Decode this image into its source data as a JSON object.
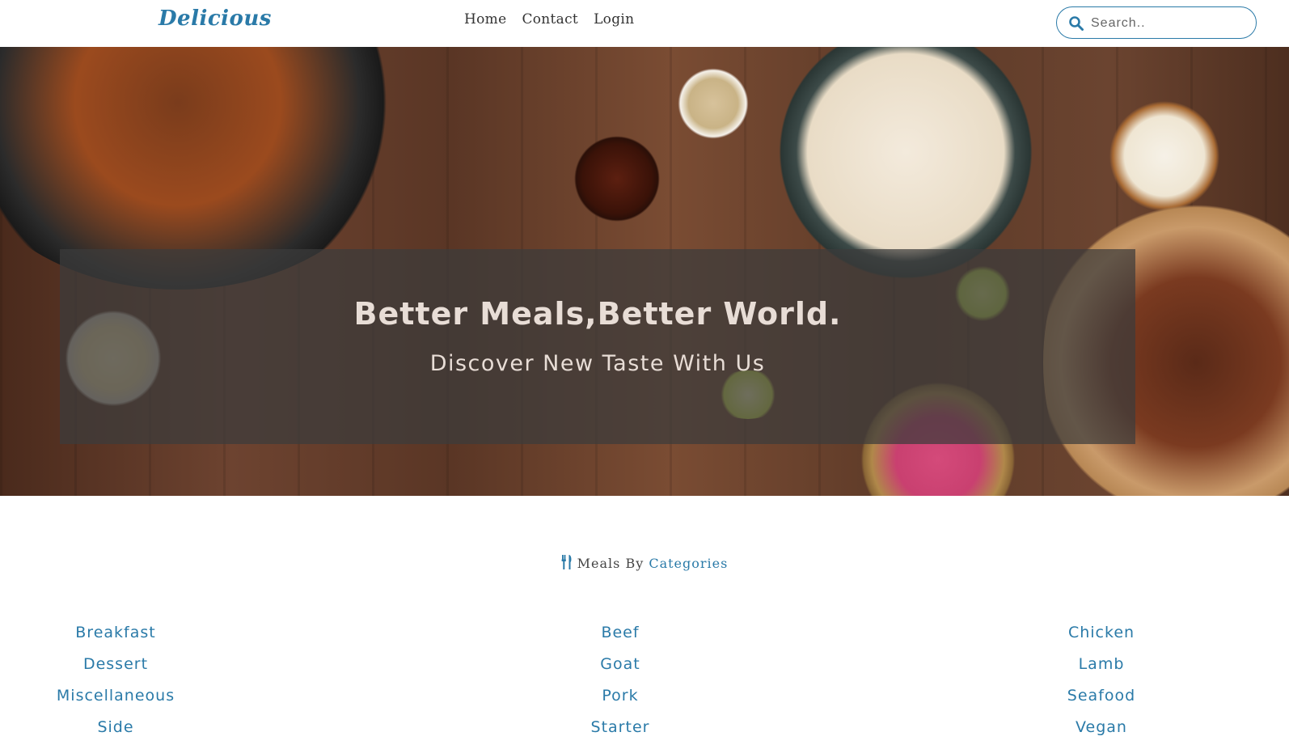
{
  "header": {
    "brand": "Delicious",
    "nav": [
      "Home",
      "Contact",
      "Login"
    ],
    "search_placeholder": "Search.."
  },
  "hero": {
    "title": "Better Meals,Better World.",
    "subtitle": "Discover New Taste With Us"
  },
  "categories": {
    "title_prefix": "Meals By",
    "title_accent": "Categories",
    "columns": [
      [
        "Breakfast",
        "Dessert",
        "Miscellaneous",
        "Side"
      ],
      [
        "Beef",
        "Goat",
        "Pork",
        "Starter"
      ],
      [
        "Chicken",
        "Lamb",
        "Seafood",
        "Vegan"
      ]
    ]
  },
  "colors": {
    "accent": "#2a7aa8",
    "text": "#333333",
    "overlay": "rgba(60,60,60,0.72)"
  }
}
